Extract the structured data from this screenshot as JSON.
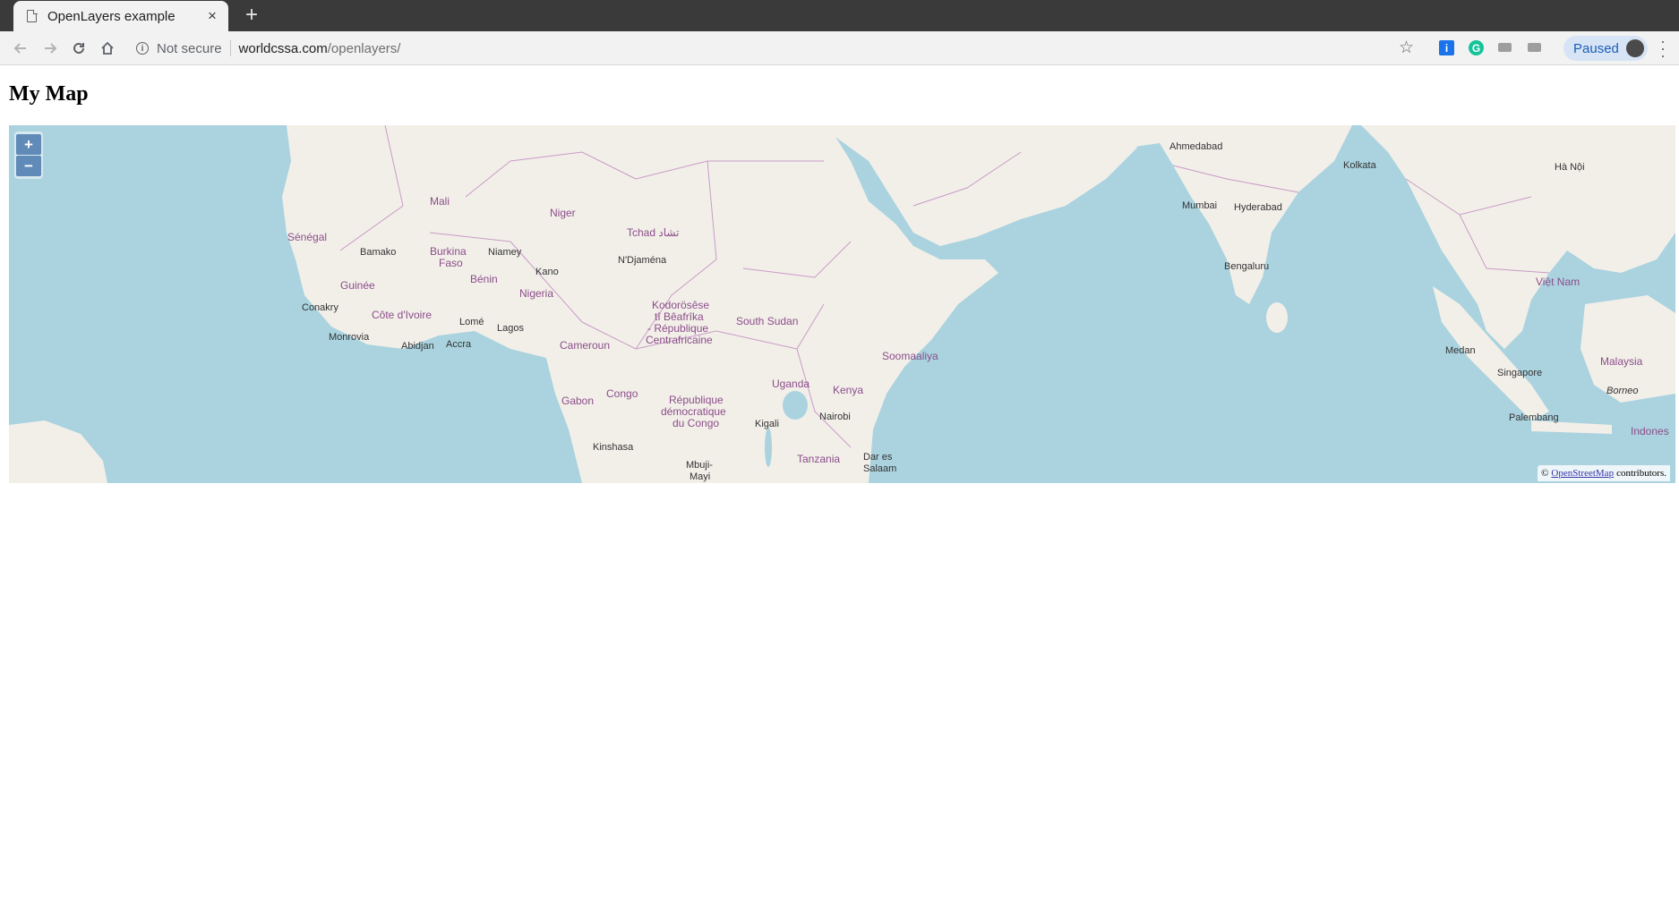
{
  "browser": {
    "tab_title": "OpenLayers example",
    "tab_close": "×",
    "new_tab": "+",
    "security_label": "Not secure",
    "url_host": "worldcssa.com",
    "url_path": "/openlayers/",
    "profile_label": "Paused",
    "icons": [
      "back-arrow-icon",
      "forward-arrow-icon",
      "reload-icon",
      "home-icon",
      "info-icon",
      "star-icon",
      "menu-dots-icon"
    ]
  },
  "page": {
    "title": "My Map"
  },
  "map": {
    "zoom_in": "+",
    "zoom_out": "−",
    "attribution_prefix": "©",
    "attribution_link": "OpenStreetMap",
    "attribution_suffix": "contributors.",
    "colors": {
      "water": "#aad3df",
      "land": "#f2efe9",
      "borders": "#c99bc6",
      "city": "#333333"
    },
    "labels": {
      "mali": "Mali",
      "niger": "Niger",
      "senegal": "Sénégal",
      "bamako": "Bamako",
      "burkina": "Burkina",
      "faso": "Faso",
      "niamey": "Niamey",
      "tchad": "Tchad تشاد",
      "ndjamena": "N'Djaména",
      "guinee": "Guinée",
      "benin": "Bénin",
      "kano": "Kano",
      "nigeria": "Nigeria",
      "conakry": "Conakry",
      "cote_divoire": "Côte d'Ivoire",
      "lome": "Lomé",
      "lagos": "Lagos",
      "monrovia": "Monrovia",
      "abidjan": "Abidjan",
      "accra": "Accra",
      "cameroun": "Cameroun",
      "kodorosese": "Kodorösêse",
      "ti_beafrika": "tî Bêafrîka",
      "rep_centrafricaine": "- République",
      "centrafricaine": "Centrafricaine",
      "south_sudan": "South Sudan",
      "gabon": "Gabon",
      "congo": "Congo",
      "rdc1": "République",
      "rdc2": "démocratique",
      "rdc3": "du Congo",
      "uganda": "Uganda",
      "kenya": "Kenya",
      "kigali": "Kigali",
      "nairobi": "Nairobi",
      "kinshasa": "Kinshasa",
      "mbuji": "Mbuji-",
      "mayi": "Mayi",
      "tanzania": "Tanzania",
      "dar_es": "Dar es",
      "salaam": "Salaam",
      "soomaaliya": "Soomaaliya",
      "ahmedabad": "Ahmedabad",
      "mumbai": "Mumbai",
      "hyderabad": "Hyderabad",
      "bengaluru": "Bengaluru",
      "kolkata": "Kolkata",
      "ha_noi": "Hà Nội",
      "viet_nam": "Việt Nam",
      "medan": "Medan",
      "singapore": "Singapore",
      "malaysia": "Malaysia",
      "borneo": "Borneo",
      "palembang": "Palembang",
      "indonesia": "Indones"
    }
  }
}
